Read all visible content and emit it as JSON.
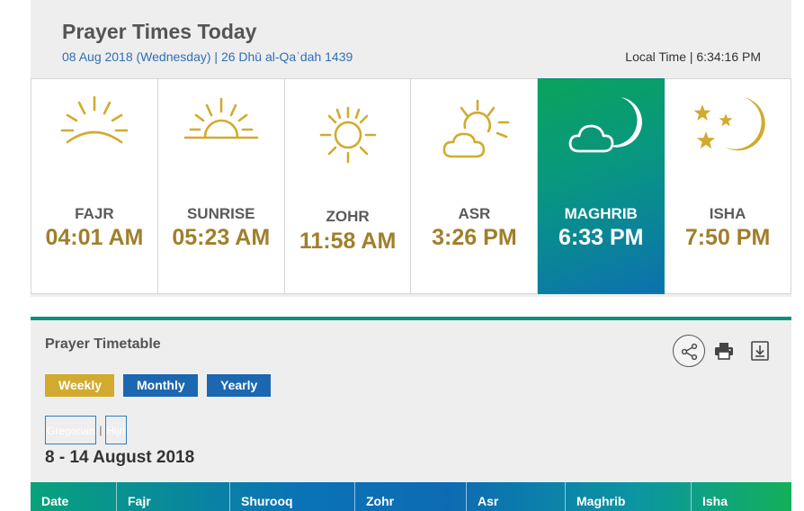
{
  "header": {
    "title": "Prayer Times Today",
    "date_line": "08 Aug 2018 (Wednesday) | 26 Dhū al-Qaʿdah 1439",
    "local_time": "Local Time | 6:34:16 PM"
  },
  "prayers": [
    {
      "name": "FAJR",
      "time": "04:01 AM",
      "icon": "sunrise-horizon-icon"
    },
    {
      "name": "SUNRISE",
      "time": "05:23 AM",
      "icon": "half-sun-icon"
    },
    {
      "name": "ZOHR",
      "time": "11:58 AM",
      "icon": "full-sun-icon"
    },
    {
      "name": "ASR",
      "time": "3:26 PM",
      "icon": "sun-cloud-icon"
    },
    {
      "name": "MAGHRIB",
      "time": "6:33 PM",
      "icon": "moon-cloud-icon",
      "active": true
    },
    {
      "name": "ISHA",
      "time": "7:50 PM",
      "icon": "moon-stars-icon"
    }
  ],
  "timetable": {
    "title": "Prayer Timetable",
    "tabs": {
      "weekly": "Weekly",
      "monthly": "Monthly",
      "yearly": "Yearly"
    },
    "calendar": {
      "gregorian": "Gregorian",
      "separator": "|",
      "hijri": "Hijri"
    },
    "range": "8 - 14 August 2018",
    "columns": [
      "Date",
      "Fajr",
      "Shurooq",
      "Zohr",
      "Asr",
      "Maghrib",
      "Isha"
    ]
  },
  "colors": {
    "gold": "#a07f2b",
    "icon_gold": "#d2aa2e",
    "blue_button": "#1b67b1",
    "weekly_button": "#d2aa2e",
    "accent_green": "#0a8f7a"
  }
}
